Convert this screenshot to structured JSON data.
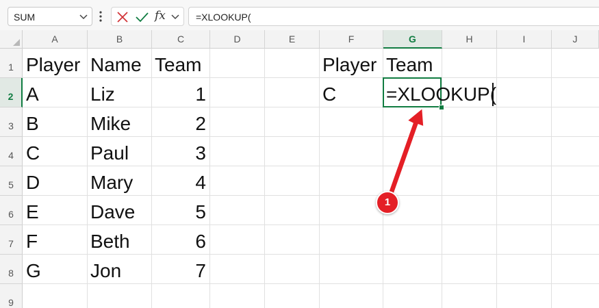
{
  "formula_bar": {
    "name_box": "SUM",
    "fx_label": "fx",
    "formula": "=XLOOKUP(",
    "icons": [
      "chevron-down-icon",
      "more-options-icon",
      "cancel-icon",
      "enter-check-icon",
      "fx-icon"
    ]
  },
  "sheet": {
    "column_headers": [
      "A",
      "B",
      "C",
      "D",
      "E",
      "F",
      "G",
      "H",
      "I",
      "J"
    ],
    "selected_column": "G",
    "row_headers": [
      "1",
      "2",
      "3",
      "4",
      "5",
      "6",
      "7",
      "8",
      "9"
    ],
    "selected_row": "2",
    "table_headers": [
      "Player",
      "Name",
      "Team"
    ],
    "table_rows": [
      [
        "A",
        "Liz",
        "1"
      ],
      [
        "B",
        "Mike",
        "2"
      ],
      [
        "C",
        "Paul",
        "3"
      ],
      [
        "D",
        "Mary",
        "4"
      ],
      [
        "E",
        "Dave",
        "5"
      ],
      [
        "F",
        "Beth",
        "6"
      ],
      [
        "G",
        "Jon",
        "7"
      ]
    ],
    "lookup_headers": [
      "Player",
      "Team"
    ],
    "lookup_value": "C",
    "active_cell_text": "=XLOOKUP("
  },
  "annotation": {
    "badge": "1",
    "color": "#e41f26"
  },
  "colors": {
    "accent": "#107c41",
    "grid": "#e0e0e0",
    "header_bg": "#f3f3f3"
  }
}
